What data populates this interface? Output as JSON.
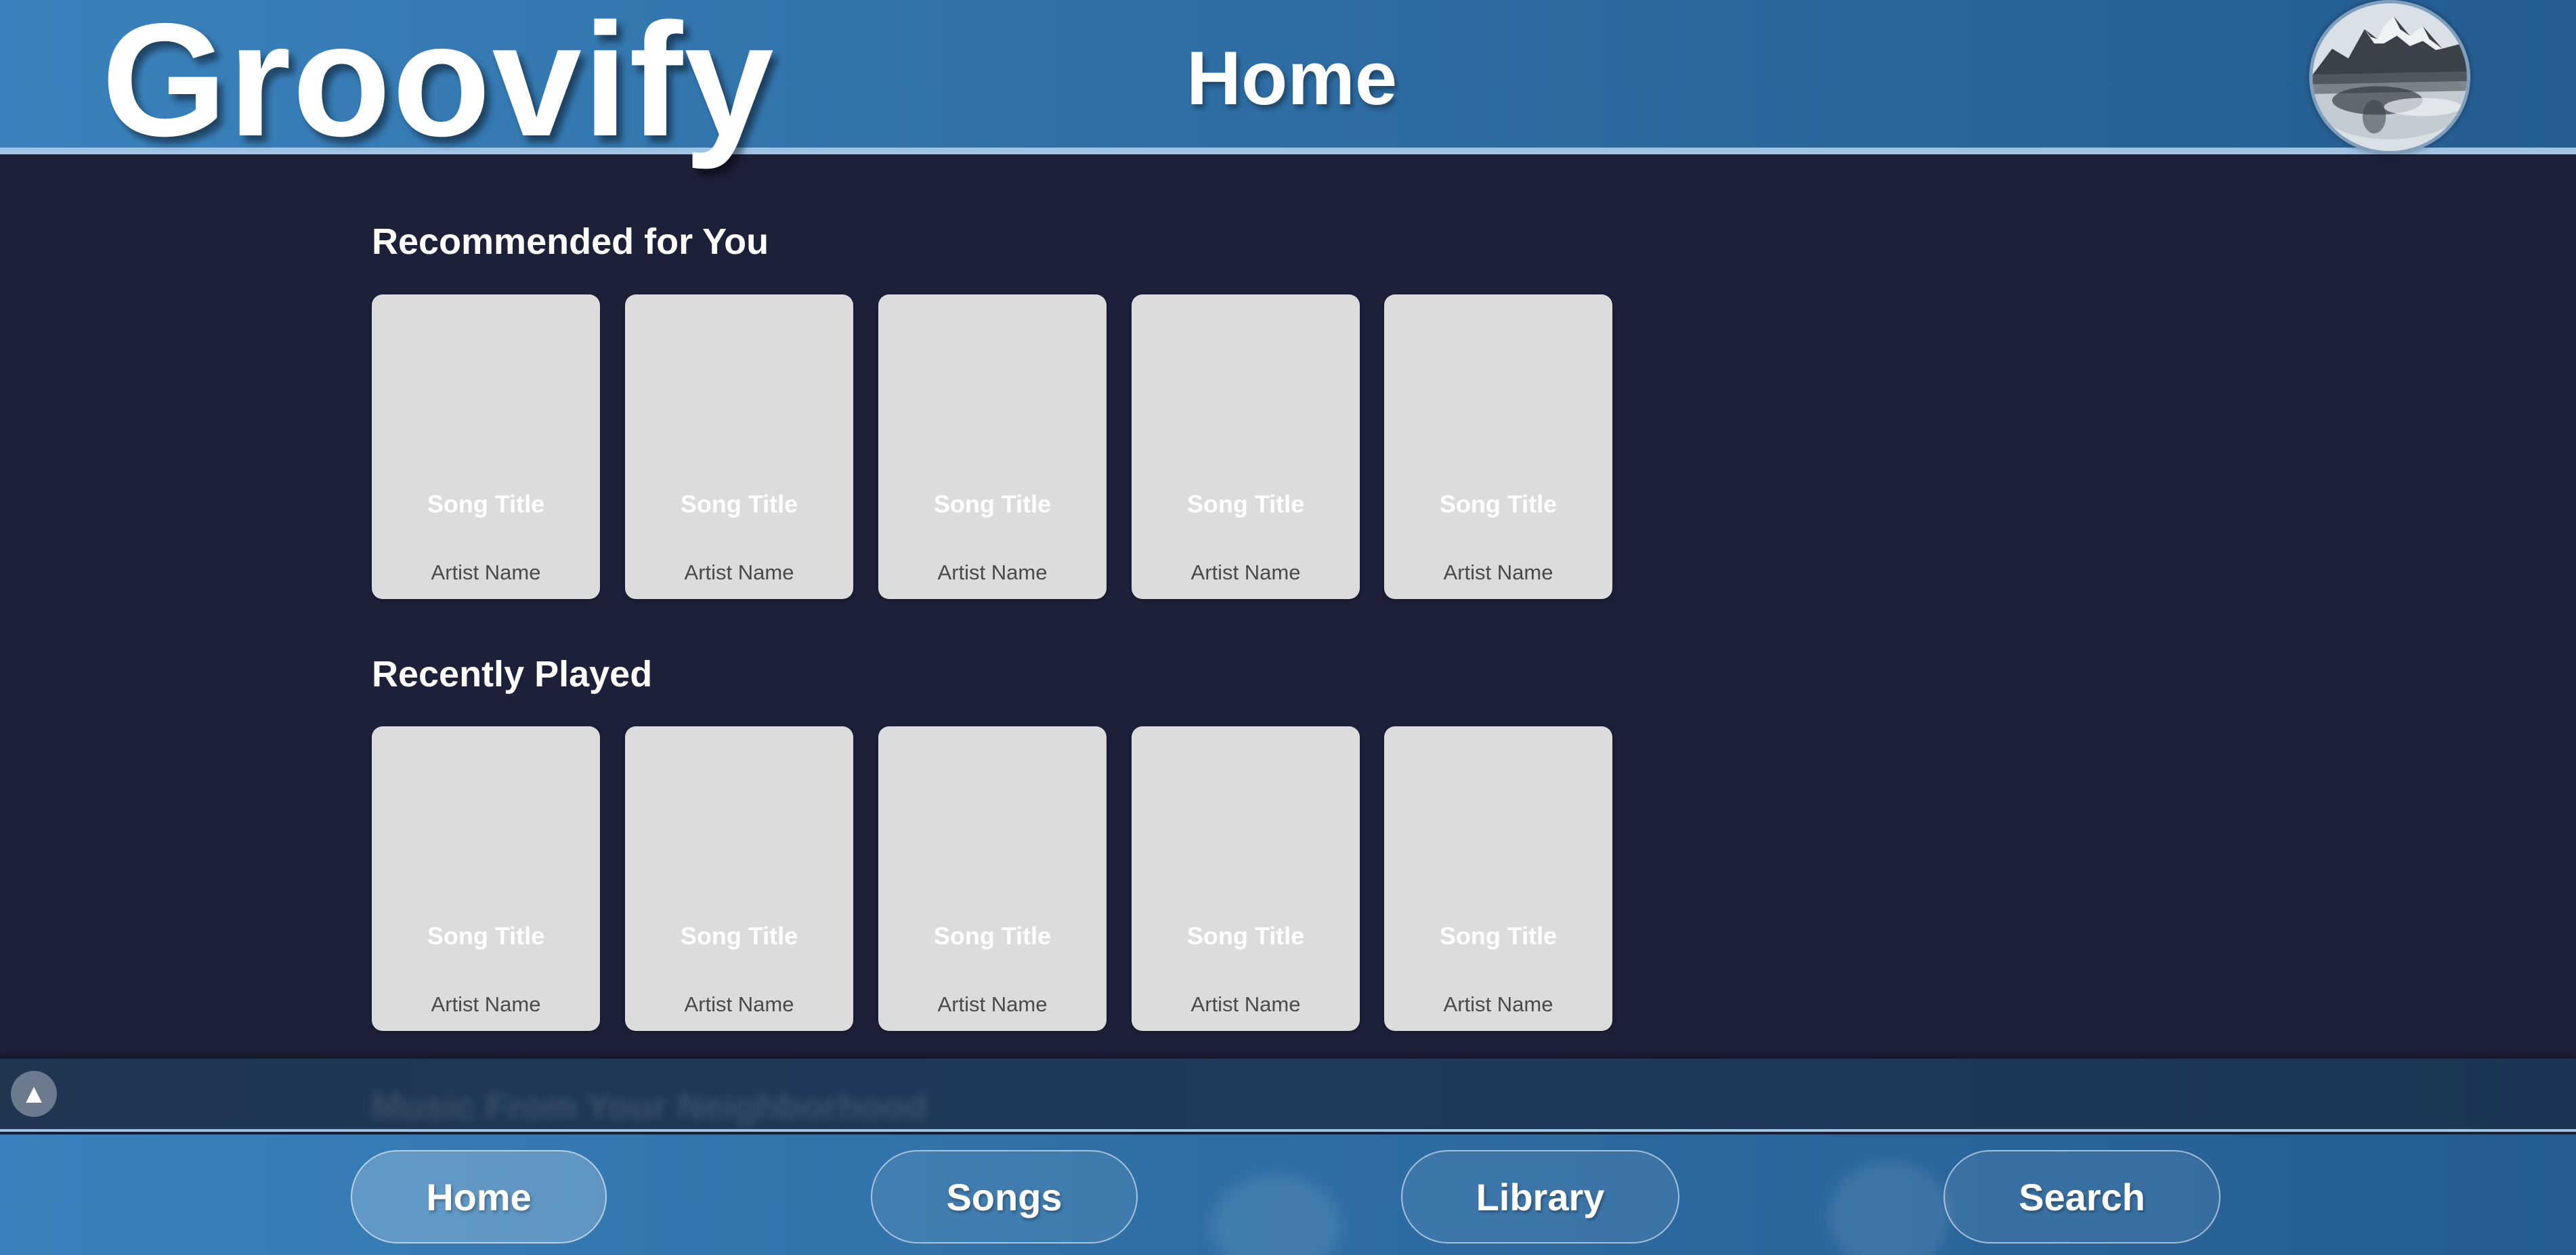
{
  "header": {
    "logo": "Groovify",
    "title": "Home",
    "avatar_icon": "mountain-avatar"
  },
  "sections": [
    {
      "heading": "Recommended for You",
      "cards": [
        {
          "title": "Song Title",
          "artist": "Artist Name"
        },
        {
          "title": "Song Title",
          "artist": "Artist Name"
        },
        {
          "title": "Song Title",
          "artist": "Artist Name"
        },
        {
          "title": "Song Title",
          "artist": "Artist Name"
        },
        {
          "title": "Song Title",
          "artist": "Artist Name"
        }
      ]
    },
    {
      "heading": "Recently Played",
      "cards": [
        {
          "title": "Song Title",
          "artist": "Artist Name"
        },
        {
          "title": "Song Title",
          "artist": "Artist Name"
        },
        {
          "title": "Song Title",
          "artist": "Artist Name"
        },
        {
          "title": "Song Title",
          "artist": "Artist Name"
        },
        {
          "title": "Song Title",
          "artist": "Artist Name"
        }
      ]
    }
  ],
  "mini_player": {
    "expand_icon": "▲",
    "ghost_heading": "Music From Your Neighborhood"
  },
  "nav": {
    "home": "Home",
    "songs": "Songs",
    "library": "Library",
    "search": "Search"
  },
  "colors": {
    "background": "#1d2039",
    "header": "#2f6fa6",
    "card": "#dcdcdc",
    "artist_text": "#4a4a4a"
  }
}
